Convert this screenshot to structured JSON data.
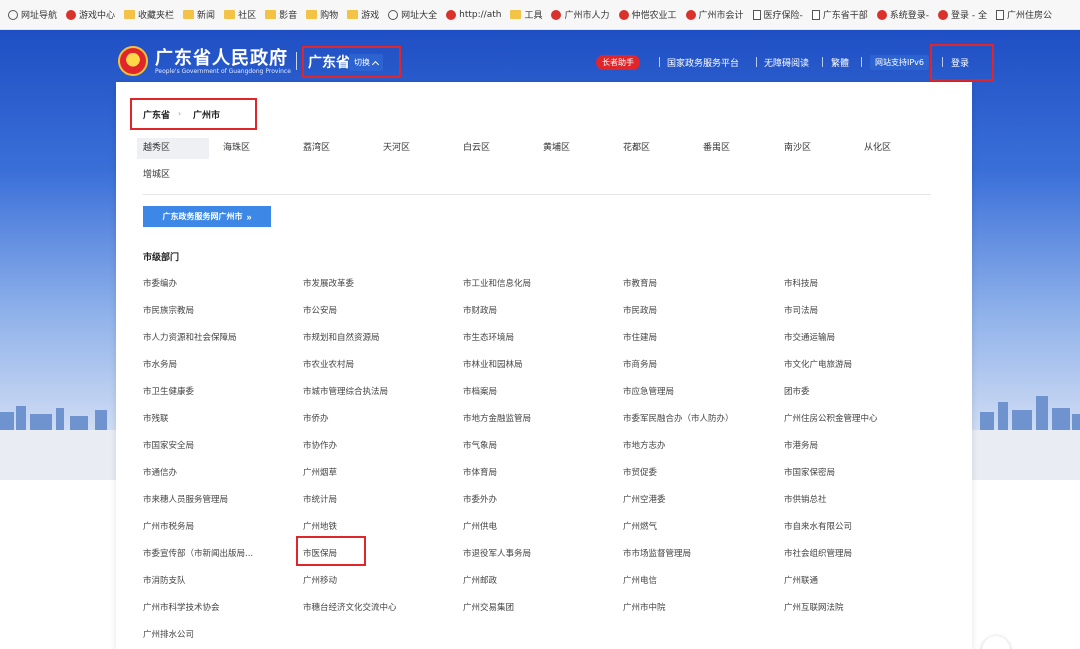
{
  "bookmarks": [
    {
      "label": "网址导航",
      "icon": "globe-icon"
    },
    {
      "label": "游戏中心",
      "icon": "red-circle-icon"
    },
    {
      "label": "收藏夹栏",
      "icon": "folder-icon"
    },
    {
      "label": "新闻",
      "icon": "folder-icon"
    },
    {
      "label": "社区",
      "icon": "folder-icon"
    },
    {
      "label": "影音",
      "icon": "folder-icon"
    },
    {
      "label": "购物",
      "icon": "folder-icon"
    },
    {
      "label": "游戏",
      "icon": "folder-icon"
    },
    {
      "label": "网址大全",
      "icon": "globe-icon"
    },
    {
      "label": "http://ath",
      "icon": "red-circle-icon"
    },
    {
      "label": "工具",
      "icon": "folder-icon"
    },
    {
      "label": "广州市人力",
      "icon": "red-circle-icon"
    },
    {
      "label": "仲恺农业工",
      "icon": "red-circle-icon"
    },
    {
      "label": "广州市会计",
      "icon": "red-circle-icon"
    },
    {
      "label": "医疗保险-",
      "icon": "document-icon"
    },
    {
      "label": "广东省干部",
      "icon": "document-icon"
    },
    {
      "label": "系统登录-",
      "icon": "red-circle-icon"
    },
    {
      "label": "登录 - 全",
      "icon": "red-circle-icon"
    },
    {
      "label": "广州住房公",
      "icon": "document-icon"
    }
  ],
  "header": {
    "site_name": "广东省人民政府",
    "site_name_en": "People's Government of Guangdong Province",
    "region": "广东省",
    "switch_label": "切换",
    "elder_assistant": "长者助手",
    "national_platform": "国家政务服务平台",
    "accessible_reading": "无障碍阅读",
    "traditional": "繁體",
    "ipv6": "网站支持IPv6",
    "login": "登录"
  },
  "breadcrumb": {
    "province": "广东省",
    "city": "广州市"
  },
  "districts": [
    "越秀区",
    "海珠区",
    "荔湾区",
    "天河区",
    "白云区",
    "黄埔区",
    "花都区",
    "番禺区",
    "南沙区",
    "从化区",
    "增城区"
  ],
  "portal_button": "广东政务服务网广州市",
  "section_title": "市级部门",
  "departments": [
    [
      "市委编办",
      "市发展改革委",
      "市工业和信息化局",
      "市教育局",
      "市科技局"
    ],
    [
      "市民族宗教局",
      "市公安局",
      "市财政局",
      "市民政局",
      "市司法局"
    ],
    [
      "市人力资源和社会保障局",
      "市规划和自然资源局",
      "市生态环境局",
      "市住建局",
      "市交通运输局"
    ],
    [
      "市水务局",
      "市农业农村局",
      "市林业和园林局",
      "市商务局",
      "市文化广电旅游局"
    ],
    [
      "市卫生健康委",
      "市城市管理综合执法局",
      "市档案局",
      "市应急管理局",
      "团市委"
    ],
    [
      "市残联",
      "市侨办",
      "市地方金融监管局",
      "市委军民融合办（市人防办）",
      "广州住房公积金管理中心"
    ],
    [
      "市国家安全局",
      "市协作办",
      "市气象局",
      "市地方志办",
      "市港务局"
    ],
    [
      "市通信办",
      "广州烟草",
      "市体育局",
      "市贸促委",
      "市国家保密局"
    ],
    [
      "市来穗人员服务管理局",
      "市统计局",
      "市委外办",
      "广州空港委",
      "市供销总社"
    ],
    [
      "广州市税务局",
      "广州地铁",
      "广州供电",
      "广州燃气",
      "市自来水有限公司"
    ],
    [
      "市委宣传部（市新闻出版局...",
      "市医保局",
      "市退役军人事务局",
      "市市场监督管理局",
      "市社会组织管理局"
    ],
    [
      "市消防支队",
      "广州移动",
      "广州邮政",
      "广州电信",
      "广州联通"
    ],
    [
      "广州市科学技术协会",
      "市穗台经济文化交流中心",
      "广州交易集团",
      "广州市中院",
      "广州互联网法院"
    ],
    [
      "广州排水公司"
    ]
  ],
  "colors": {
    "primary_blue": "#1f4fc4",
    "accent_red": "#e0262a",
    "button_blue": "#3d88e6"
  }
}
